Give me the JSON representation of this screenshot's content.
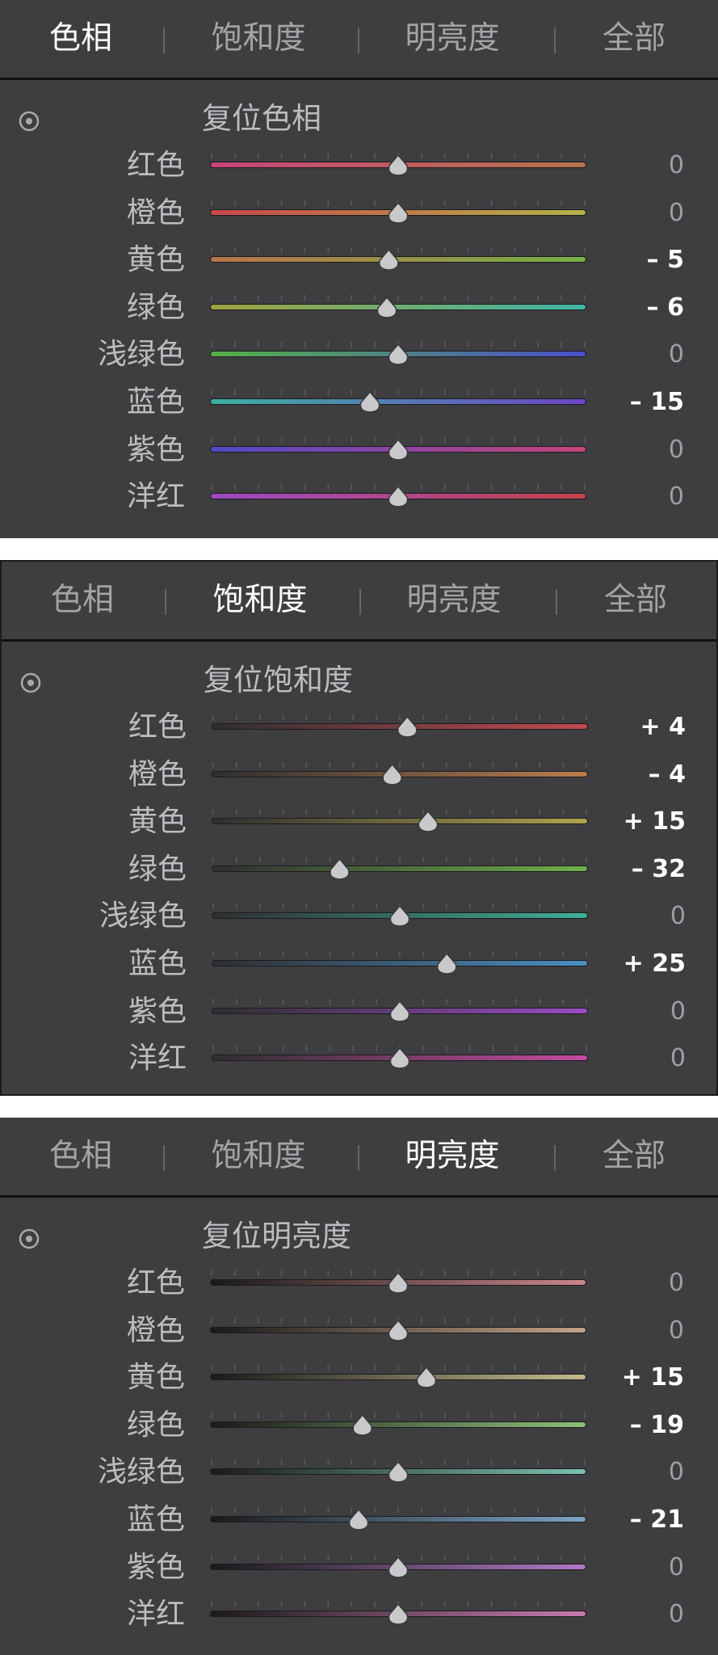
{
  "tabs": [
    "色相",
    "饱和度",
    "明亮度",
    "全部"
  ],
  "icons": {
    "target_adjust": "target-adjust-icon"
  },
  "panels": [
    {
      "active_tab": 0,
      "reset_label": "复位色相",
      "rows": [
        {
          "label": "红色",
          "value": 0,
          "display": "0",
          "track_colors": [
            "#c7457a",
            "#b8744a"
          ]
        },
        {
          "label": "橙色",
          "value": 0,
          "display": "0",
          "track_colors": [
            "#c9474b",
            "#b4b24a"
          ]
        },
        {
          "label": "黄色",
          "value": -5,
          "display": "– 5",
          "track_colors": [
            "#b8744a",
            "#76b046"
          ]
        },
        {
          "label": "绿色",
          "value": -6,
          "display": "– 6",
          "track_colors": [
            "#a0a33e",
            "#3fb6a6"
          ]
        },
        {
          "label": "浅绿色",
          "value": 0,
          "display": "0",
          "track_colors": [
            "#54b144",
            "#4a50c9"
          ]
        },
        {
          "label": "蓝色",
          "value": -15,
          "display": "– 15",
          "track_colors": [
            "#3db0a1",
            "#6d45c6"
          ]
        },
        {
          "label": "紫色",
          "value": 0,
          "display": "0",
          "track_colors": [
            "#5048c8",
            "#c8457a"
          ]
        },
        {
          "label": "洋红",
          "value": 0,
          "display": "0",
          "track_colors": [
            "#9c49c4",
            "#c4454e"
          ]
        }
      ]
    },
    {
      "active_tab": 1,
      "reset_label": "复位饱和度",
      "rows": [
        {
          "label": "红色",
          "value": 4,
          "display": "+ 4",
          "track_colors": [
            "#2e2e30",
            "#c14a4e"
          ]
        },
        {
          "label": "橙色",
          "value": -4,
          "display": "– 4",
          "track_colors": [
            "#2e2e30",
            "#b87d4e"
          ]
        },
        {
          "label": "黄色",
          "value": 15,
          "display": "+ 15",
          "track_colors": [
            "#2e2e30",
            "#b0a24d"
          ]
        },
        {
          "label": "绿色",
          "value": -32,
          "display": "– 32",
          "track_colors": [
            "#2e2e30",
            "#6eb04b"
          ]
        },
        {
          "label": "浅绿色",
          "value": 0,
          "display": "0",
          "track_colors": [
            "#2e2e30",
            "#3fb097"
          ]
        },
        {
          "label": "蓝色",
          "value": 25,
          "display": "+ 25",
          "track_colors": [
            "#2e2e30",
            "#4b8fc2"
          ]
        },
        {
          "label": "紫色",
          "value": 0,
          "display": "0",
          "track_colors": [
            "#2e2e30",
            "#9a4bc4"
          ]
        },
        {
          "label": "洋红",
          "value": 0,
          "display": "0",
          "track_colors": [
            "#2e2e30",
            "#c44aa0"
          ]
        }
      ]
    },
    {
      "active_tab": 2,
      "reset_label": "复位明亮度",
      "rows": [
        {
          "label": "红色",
          "value": 0,
          "display": "0",
          "track_colors": [
            "#1a1a1a",
            "#c9868a"
          ]
        },
        {
          "label": "橙色",
          "value": 0,
          "display": "0",
          "track_colors": [
            "#1a1a1a",
            "#c2a286"
          ]
        },
        {
          "label": "黄色",
          "value": 15,
          "display": "+ 15",
          "track_colors": [
            "#1a1a1a",
            "#c4bb8c"
          ]
        },
        {
          "label": "绿色",
          "value": -19,
          "display": "– 19",
          "track_colors": [
            "#1a1a1a",
            "#8ec07a"
          ]
        },
        {
          "label": "浅绿色",
          "value": 0,
          "display": "0",
          "track_colors": [
            "#1a1a1a",
            "#7cc0ae"
          ]
        },
        {
          "label": "蓝色",
          "value": -21,
          "display": "– 21",
          "track_colors": [
            "#1a1a1a",
            "#7ca4c6"
          ]
        },
        {
          "label": "紫色",
          "value": 0,
          "display": "0",
          "track_colors": [
            "#1a1a1a",
            "#b07ac6"
          ]
        },
        {
          "label": "洋红",
          "value": 0,
          "display": "0",
          "track_colors": [
            "#1a1a1a",
            "#c87ab0"
          ]
        }
      ]
    }
  ]
}
